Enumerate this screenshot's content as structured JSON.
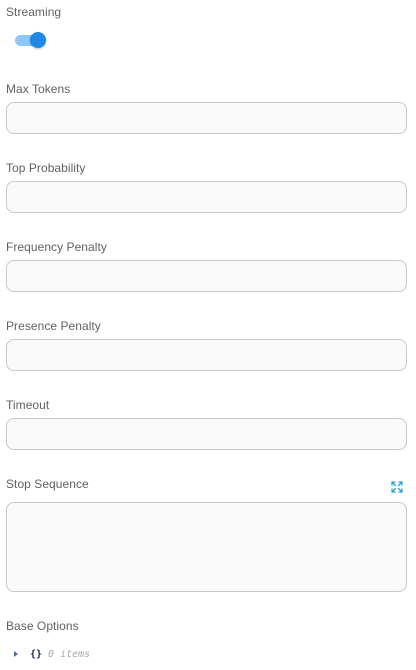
{
  "streaming": {
    "label": "Streaming",
    "enabled": true
  },
  "max_tokens": {
    "label": "Max Tokens",
    "value": ""
  },
  "top_probability": {
    "label": "Top Probability",
    "value": ""
  },
  "frequency_penalty": {
    "label": "Frequency Penalty",
    "value": ""
  },
  "presence_penalty": {
    "label": "Presence Penalty",
    "value": ""
  },
  "timeout": {
    "label": "Timeout",
    "value": ""
  },
  "stop_sequence": {
    "label": "Stop Sequence",
    "value": "",
    "expand_icon": "expand-arrows-icon"
  },
  "base_options": {
    "label": "Base Options",
    "brace": "{}",
    "count_text": "0 items"
  },
  "colors": {
    "accent": "#1e88e5",
    "accent_light": "#8fc7f6",
    "border": "#c9c9c9",
    "field_bg": "#fafafa"
  }
}
